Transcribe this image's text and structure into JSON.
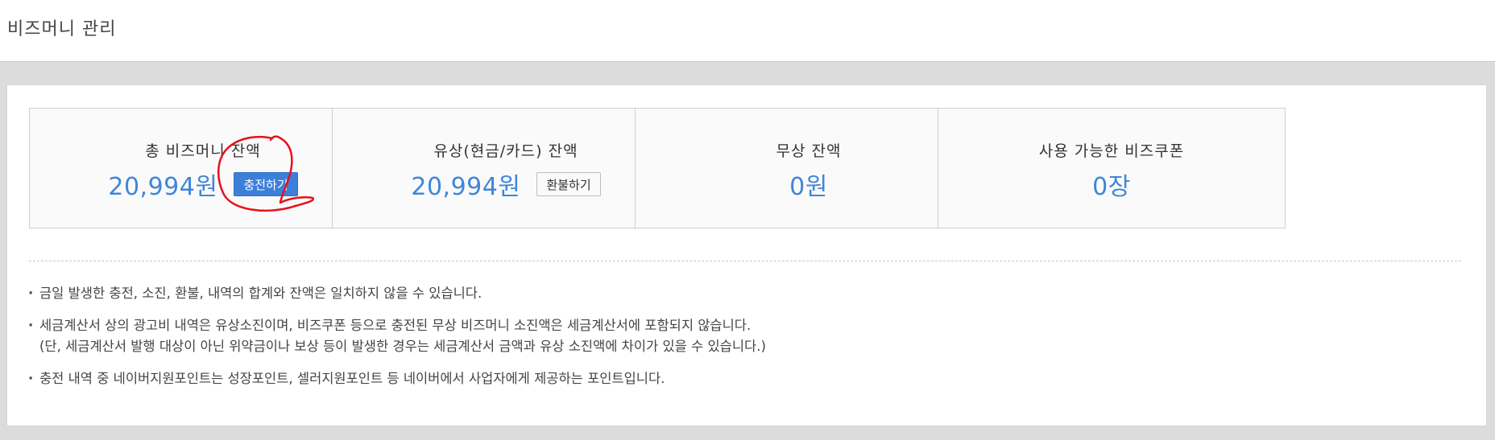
{
  "header": {
    "title": "비즈머니 관리"
  },
  "cards": [
    {
      "title": "총 비즈머니 잔액",
      "amount": "20,994원",
      "button": "충전하기"
    },
    {
      "title": "유상(현금/카드) 잔액",
      "amount": "20,994원",
      "button": "환불하기"
    },
    {
      "title": "무상 잔액",
      "amount": "0원"
    },
    {
      "title": "사용 가능한 비즈쿠폰",
      "amount": "0장"
    }
  ],
  "notes": [
    {
      "text": "금일 발생한 충전, 소진, 환불, 내역의 합계와 잔액은 일치하지 않을 수 있습니다."
    },
    {
      "text": "세금계산서 상의 광고비 내역은 유상소진이며, 비즈쿠폰 등으로 충전된 무상 비즈머니 소진액은 세금계산서에 포함되지 않습니다.",
      "sub": "(단, 세금계산서 발행 대상이 아닌 위약금이나 보상 등이 발생한 경우는 세금계산서 금액과 유상 소진액에 차이가 있을 수 있습니다.)"
    },
    {
      "text": "충전 내역 중 네이버지원포인트는 성장포인트, 셀러지원포인트 등 네이버에서 사업자에게 제공하는 포인트입니다."
    }
  ],
  "colors": {
    "accent": "#3f86d9",
    "charge_button": "#3d7fd8",
    "annotation_mark": "#e8101a"
  }
}
